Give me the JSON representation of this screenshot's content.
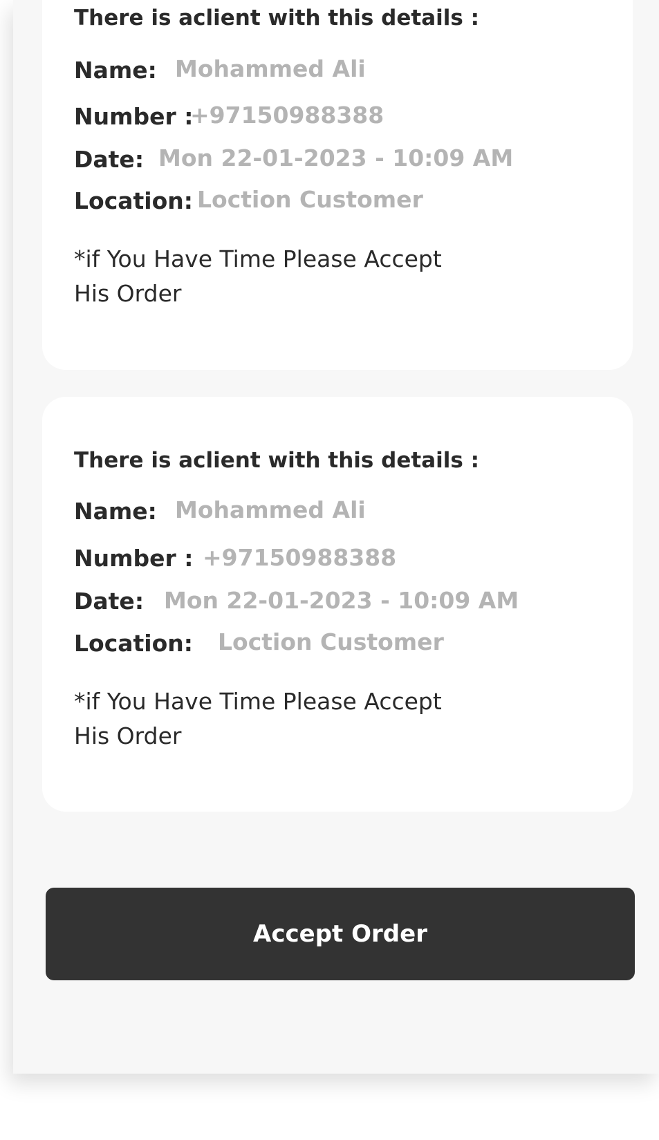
{
  "cards": [
    {
      "heading": "There is aclient with this details :",
      "name_label": "Name:",
      "name_value": "Mohammed Ali",
      "number_label": "Number :",
      "number_value": "+97150988388",
      "date_label": "Date:",
      "date_value": "Mon 22-01-2023 - 10:09 AM",
      "location_label": "Location:",
      "location_value": "Loction Customer",
      "note": "*if You Have Time Please Accept His Order"
    },
    {
      "heading": "There is aclient with this details :",
      "name_label": "Name:",
      "name_value": "Mohammed Ali",
      "number_label": "Number :",
      "number_value": "+97150988388",
      "date_label": "Date:",
      "date_value": "Mon 22-01-2023 - 10:09 AM",
      "location_label": "Location:",
      "location_value": "Loction Customer",
      "note": "*if You Have Time Please Accept His Order"
    }
  ],
  "accept_button": {
    "label": "Accept Order"
  },
  "colors": {
    "panel_background": "#f7f7f7",
    "card_background": "#ffffff",
    "label_text": "#2a2a2a",
    "value_text": "#b4b4b4",
    "button_background": "#333333",
    "button_text": "#ffffff"
  }
}
